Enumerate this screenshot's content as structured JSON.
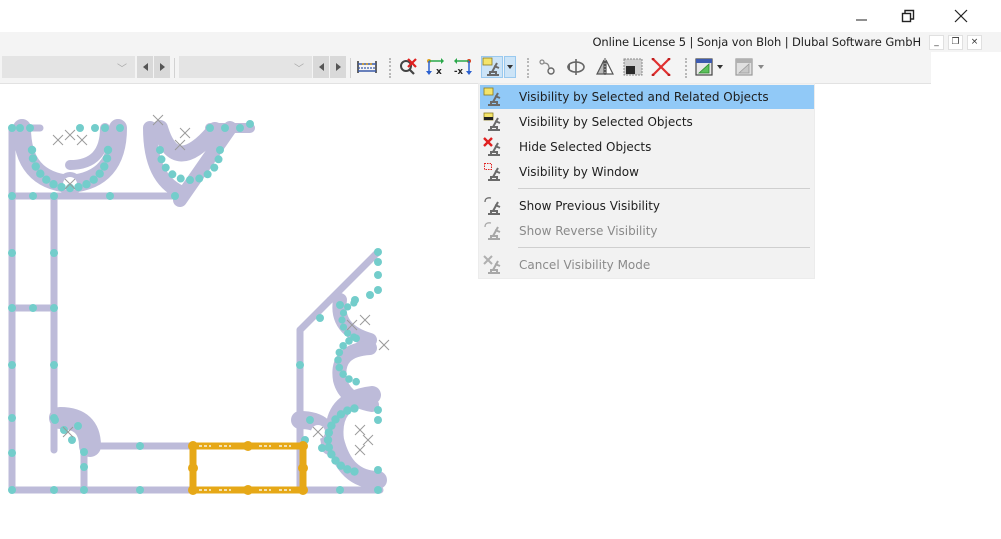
{
  "window": {
    "controls": {
      "minimize_icon": "minimize-icon",
      "restore_icon": "restore-icon",
      "close_icon": "close-icon"
    }
  },
  "license_bar": {
    "text": "Online License 5 | Sonja von Bloh | Dlubal Software GmbH",
    "mdi_minimize": "_",
    "mdi_restore": "❐",
    "mdi_close": "×"
  },
  "toolbar": {
    "combo1": {
      "value": ""
    },
    "combo2": {
      "value": ""
    },
    "icons": [
      "beam-grid-icon",
      "deselect-magnifier-icon",
      "local-axis-x-icon",
      "local-axis-minus-x-icon",
      "visibility-mode-icon",
      "connect-nodes-icon",
      "rotate-icon",
      "mirror-icon",
      "select-window-icon",
      "delete-x-icon",
      "view-settings-icon",
      "view-settings-disabled-icon"
    ],
    "accent": "#cce4f7"
  },
  "menu": {
    "items": [
      {
        "label": "Visibility by Selected and Related Objects",
        "icon": "visibility-selected-related-icon",
        "highlighted": true,
        "disabled": false
      },
      {
        "label": "Visibility by Selected Objects",
        "icon": "visibility-selected-icon",
        "highlighted": false,
        "disabled": false
      },
      {
        "label": "Hide Selected Objects",
        "icon": "hide-selected-icon",
        "highlighted": false,
        "disabled": false
      },
      {
        "label": "Visibility by Window",
        "icon": "visibility-window-icon",
        "highlighted": false,
        "disabled": false
      },
      {
        "label": "Show Previous Visibility",
        "icon": "previous-visibility-icon",
        "highlighted": false,
        "disabled": false
      },
      {
        "label": "Show Reverse Visibility",
        "icon": "reverse-visibility-icon",
        "highlighted": false,
        "disabled": true
      },
      {
        "label": "Cancel Visibility Mode",
        "icon": "cancel-visibility-icon",
        "highlighted": false,
        "disabled": true
      }
    ],
    "highlight_color": "#91c9f7"
  },
  "model_view": {
    "colors": {
      "member": "#bdbbd9",
      "node": "#73cdcb",
      "selected": "#e6a817",
      "support_mark": "#9a9a9a"
    }
  }
}
